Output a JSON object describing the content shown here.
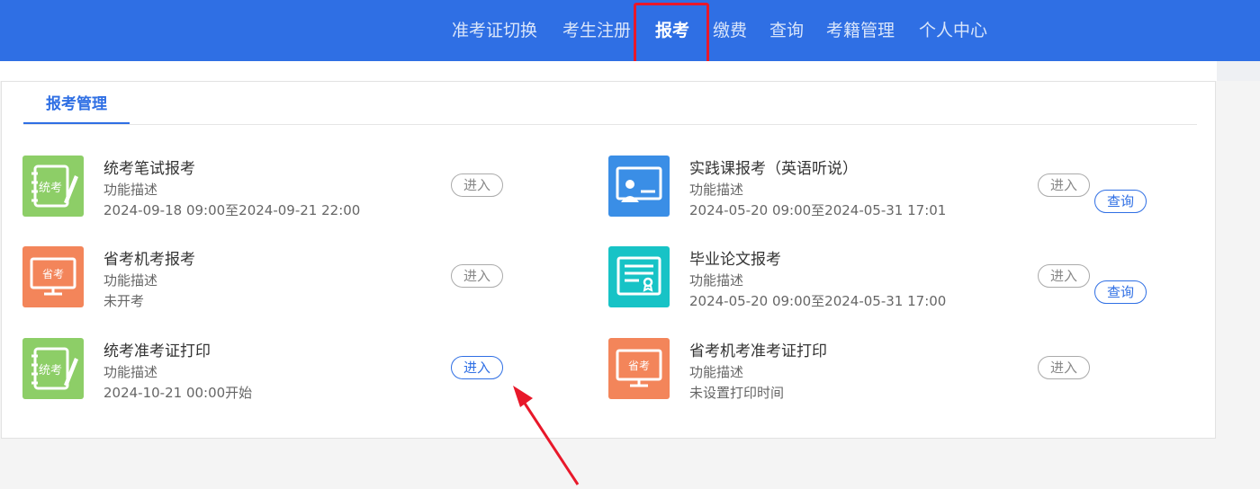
{
  "nav": {
    "items": [
      {
        "label": "准考证切换"
      },
      {
        "label": "考生注册"
      },
      {
        "label": "报考"
      },
      {
        "label": "缴费"
      },
      {
        "label": "查询"
      },
      {
        "label": "考籍管理"
      },
      {
        "label": "个人中心"
      }
    ],
    "active": "报考"
  },
  "tab": {
    "label": "报考管理"
  },
  "cards": [
    {
      "title": "统考笔试报考",
      "desc": "功能描述",
      "info": "2024-09-18 09:00至2024-09-21 22:00",
      "icon": "notebook-icon",
      "enter_label": "进入"
    },
    {
      "title": "实践课报考（英语听说）",
      "desc": "功能描述",
      "info": "2024-05-20 09:00至2024-05-31 17:01",
      "icon": "classroom-icon",
      "enter_label": "进入",
      "query_label": "查询"
    },
    {
      "title": "省考机考报考",
      "desc": "功能描述",
      "info": "未开考",
      "icon": "monitor-icon",
      "enter_label": "进入"
    },
    {
      "title": "毕业论文报考",
      "desc": "功能描述",
      "info": "2024-05-20 09:00至2024-05-31 17:00",
      "icon": "certificate-icon",
      "enter_label": "进入",
      "query_label": "查询"
    },
    {
      "title": "统考准考证打印",
      "desc": "功能描述",
      "info": "2024-10-21 00:00开始",
      "icon": "notebook-icon",
      "enter_label": "进入"
    },
    {
      "title": "省考机考准考证打印",
      "desc": "功能描述",
      "info": "未设置打印时间",
      "icon": "monitor-icon",
      "enter_label": "进入"
    }
  ],
  "icon_text": {
    "notebook": "统考",
    "monitor": "省考"
  },
  "colors": {
    "header": "#2f6fe4",
    "highlight": "#e8182a",
    "green": "#8dce67",
    "orange": "#f3855a",
    "blue": "#3a8ee6",
    "teal": "#17c3c6"
  }
}
